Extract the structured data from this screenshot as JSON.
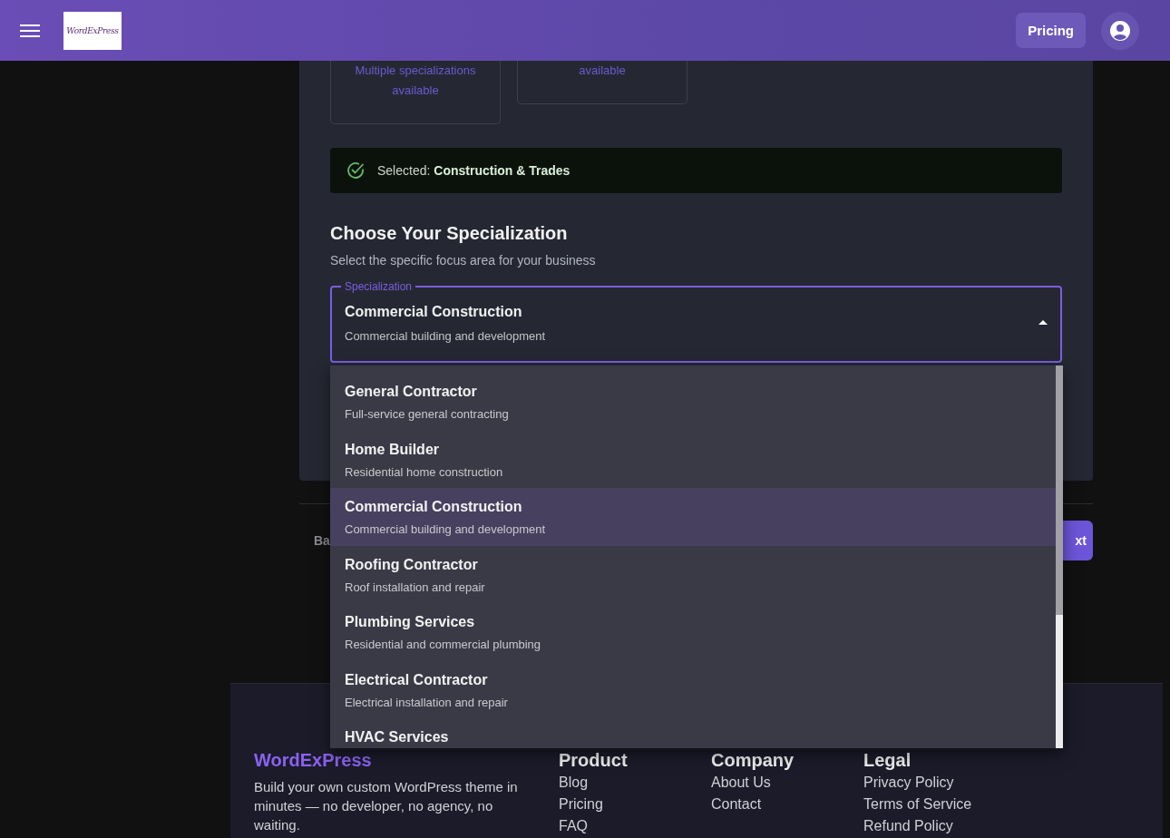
{
  "header": {
    "logo_text": "WordExPress",
    "pricing": "Pricing"
  },
  "category_cards": [
    {
      "text": "Multiple specializations available"
    },
    {
      "text": "available"
    }
  ],
  "selected_banner": {
    "label": "Selected:",
    "value": "Construction & Trades"
  },
  "specialization": {
    "heading": "Choose Your Specialization",
    "subtitle": "Select the specific focus area for your business",
    "field": {
      "label": "Specialization",
      "value": "Commercial Construction",
      "description": "Commercial building and development",
      "expanded": true
    },
    "options": [
      {
        "title": "General Contractor",
        "description": "Full-service general contracting",
        "selected": false
      },
      {
        "title": "Home Builder",
        "description": "Residential home construction",
        "selected": false
      },
      {
        "title": "Commercial Construction",
        "description": "Commercial building and development",
        "selected": true
      },
      {
        "title": "Roofing Contractor",
        "description": "Roof installation and repair",
        "selected": false
      },
      {
        "title": "Plumbing Services",
        "description": "Residential and commercial plumbing",
        "selected": false
      },
      {
        "title": "Electrical Contractor",
        "description": "Electrical installation and repair",
        "selected": false
      },
      {
        "title": "HVAC Services",
        "selected": false
      }
    ]
  },
  "navigation_buttons": {
    "back": "Ba",
    "next": "xt"
  },
  "footer": {
    "brand": "WordExPress",
    "tagline": "Build your own custom WordPress theme in minutes — no developer, no agency, no waiting.",
    "columns": [
      {
        "heading": "Product",
        "links": [
          "Blog",
          "Pricing",
          "FAQ"
        ]
      },
      {
        "heading": "Company",
        "links": [
          "About Us",
          "Contact"
        ]
      },
      {
        "heading": "Legal",
        "links": [
          "Privacy Policy",
          "Terms of Service",
          "Refund Policy"
        ]
      }
    ]
  }
}
